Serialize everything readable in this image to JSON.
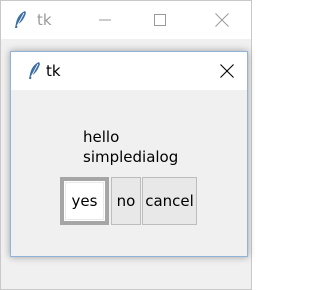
{
  "main_window": {
    "title": "tk"
  },
  "dialog": {
    "title": "tk",
    "message_lines": [
      "hello",
      "simpledialog"
    ],
    "buttons": {
      "yes": "yes",
      "no": "no",
      "cancel": "cancel"
    }
  },
  "icons": {
    "app": "tk-feather-icon",
    "minimize": "minimize-icon",
    "maximize": "maximize-icon",
    "close": "close-icon"
  },
  "colors": {
    "titlebar_inactive_text": "#9a9a9a",
    "dialog_border": "#8fb3d9",
    "feather_blue": "#3b6ea5"
  }
}
